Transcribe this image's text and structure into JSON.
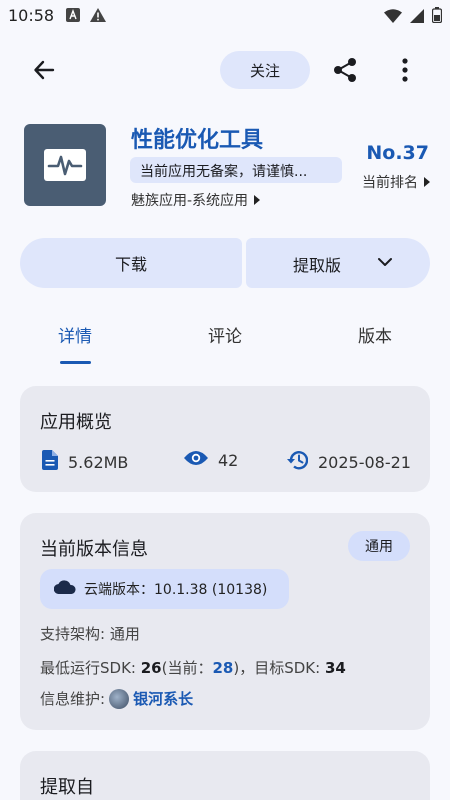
{
  "status_bar": {
    "time": "10:58"
  },
  "top_bar": {
    "follow_label": "关注"
  },
  "app": {
    "name": "性能优化工具",
    "notice": "当前应用无备案，请谨慎...",
    "category": "魅族应用-系统应用",
    "rank": "No.37",
    "rank_label": "当前排名",
    "icon_color": "#4a5d73"
  },
  "actions": {
    "download_label": "下载",
    "extract_label": "提取版"
  },
  "tabs": [
    {
      "label": "详情",
      "active": true
    },
    {
      "label": "评论",
      "active": false
    },
    {
      "label": "版本",
      "active": false
    }
  ],
  "overview": {
    "title": "应用概览",
    "size": "5.62MB",
    "views": "42",
    "date": "2025-08-21"
  },
  "version_info": {
    "title": "当前版本信息",
    "badge": "通用",
    "cloud_version": "云端版本：10.1.38 (10138)",
    "arch": "支持架构: 通用",
    "sdk_min_label": "最低运行SDK: ",
    "sdk_min": "26",
    "sdk_current_label": "(当前：",
    "sdk_current": "28",
    "sdk_target_label": ")，目标SDK: ",
    "sdk_target": "34",
    "maintainer_label": "信息维护: ",
    "maintainer": "银河系长"
  },
  "source": {
    "title": "提取自"
  },
  "colors": {
    "accent": "#1a59b3",
    "chip": "#dfe6fb",
    "card": "#e8e9f0"
  }
}
